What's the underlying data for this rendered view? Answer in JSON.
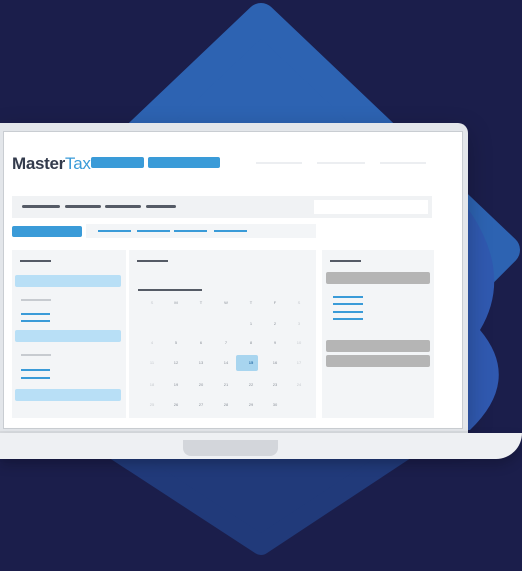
{
  "app": {
    "logo_bold": "Master",
    "logo_light": "Tax"
  },
  "calendar": {
    "weekdays": [
      "S",
      "M",
      "T",
      "W",
      "T",
      "F",
      "S"
    ],
    "weeks": [
      [
        "",
        "",
        "",
        "",
        "1",
        "2",
        "3"
      ],
      [
        "4",
        "5",
        "6",
        "7",
        "8",
        "9",
        "10"
      ],
      [
        "11",
        "12",
        "13",
        "14",
        "15",
        "16",
        "17"
      ],
      [
        "18",
        "19",
        "20",
        "21",
        "22",
        "23",
        "24"
      ],
      [
        "25",
        "26",
        "27",
        "28",
        "29",
        "30",
        ""
      ]
    ],
    "selected_day": "15"
  },
  "colors": {
    "background": "#1b1e4b",
    "accent": "#3a9bd8",
    "light_accent": "#b8dff6",
    "diamond": "#2d63b2"
  }
}
